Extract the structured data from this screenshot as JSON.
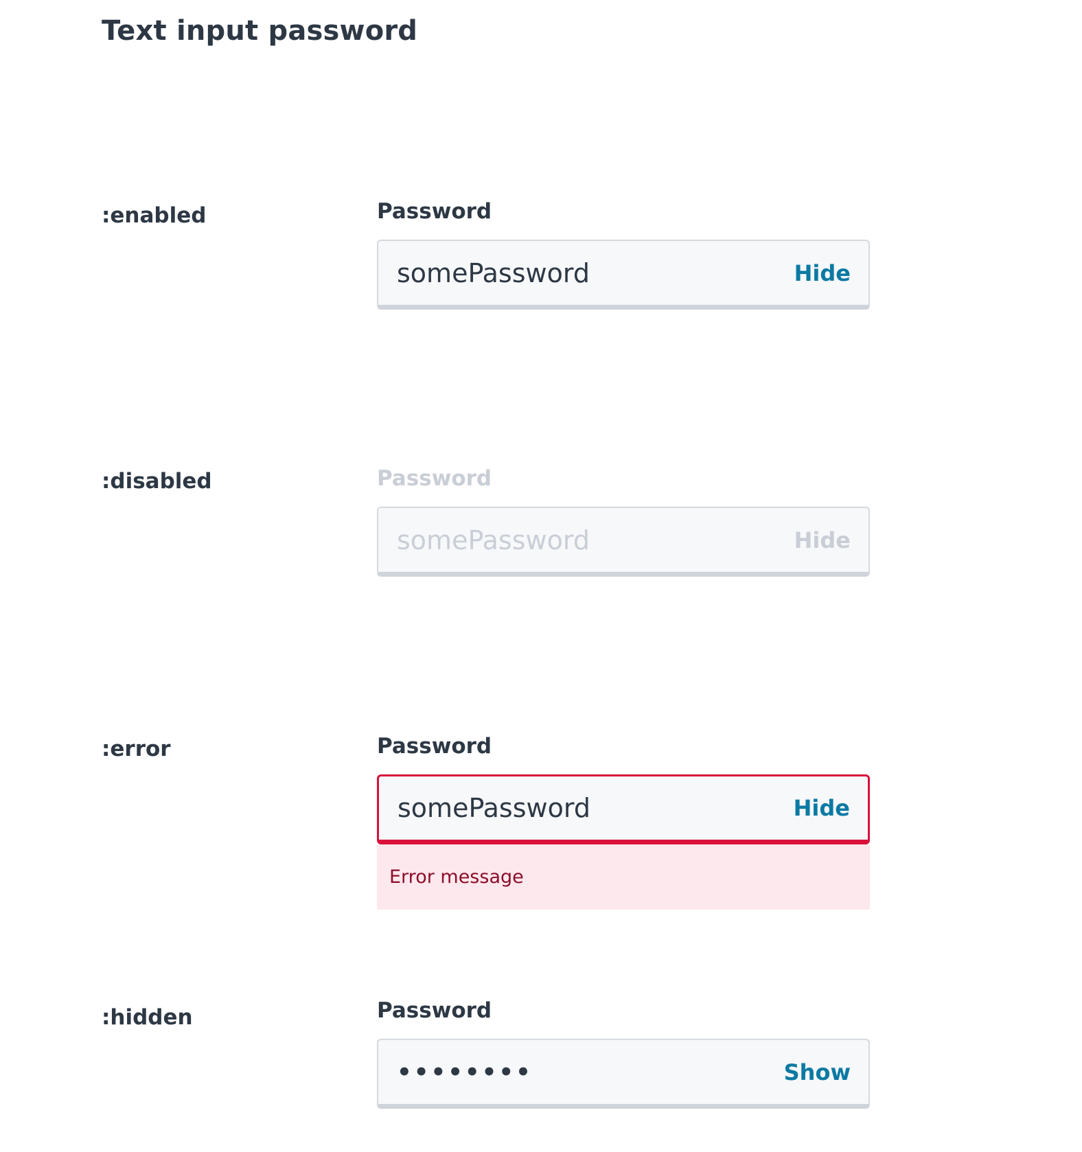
{
  "page": {
    "title": "Text input password"
  },
  "states": [
    {
      "state_label": ":enabled",
      "field_label": "Password",
      "value": "somePassword",
      "toggle_label": "Hide"
    },
    {
      "state_label": ":disabled",
      "field_label": "Password",
      "value": "somePassword",
      "toggle_label": "Hide"
    },
    {
      "state_label": ":error",
      "field_label": "Password",
      "value": "somePassword",
      "toggle_label": "Hide",
      "error_message": "Error message"
    },
    {
      "state_label": ":hidden",
      "field_label": "Password",
      "value": "••••••••",
      "toggle_label": "Show"
    }
  ],
  "colors": {
    "text": "#2d3844",
    "accent": "#0b7aa3",
    "disabled": "#c9ced6",
    "error_border": "#d9113a",
    "error_background": "#fde8ed",
    "error_text": "#8d0d2a"
  }
}
